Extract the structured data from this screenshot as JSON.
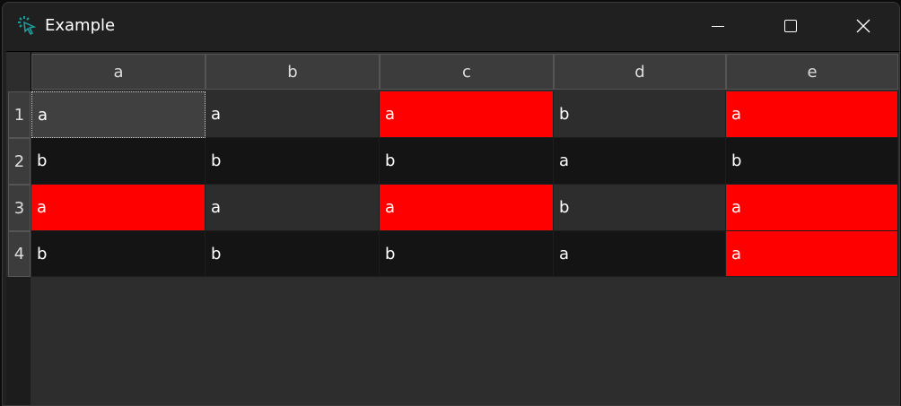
{
  "window": {
    "title": "Example",
    "icon": "cursor-click-icon",
    "controls": [
      "minimize-icon",
      "maximize-icon",
      "close-icon"
    ]
  },
  "table": {
    "columns": [
      "a",
      "b",
      "c",
      "d",
      "e"
    ],
    "row_headers": [
      "1",
      "2",
      "3",
      "4"
    ],
    "rows": [
      [
        "a",
        "a",
        "a",
        "b",
        "a"
      ],
      [
        "b",
        "b",
        "b",
        "a",
        "b"
      ],
      [
        "a",
        "a",
        "a",
        "b",
        "a"
      ],
      [
        "b",
        "b",
        "b",
        "a",
        "a"
      ]
    ],
    "highlighted": [
      [
        false,
        false,
        true,
        false,
        true
      ],
      [
        false,
        false,
        false,
        false,
        false
      ],
      [
        true,
        false,
        true,
        false,
        true
      ],
      [
        false,
        false,
        false,
        false,
        true
      ]
    ],
    "selected_cell": [
      0,
      0
    ],
    "colors": {
      "highlight": "#ff0000",
      "row_even": "#2d2d2d",
      "row_odd": "#141414"
    }
  }
}
